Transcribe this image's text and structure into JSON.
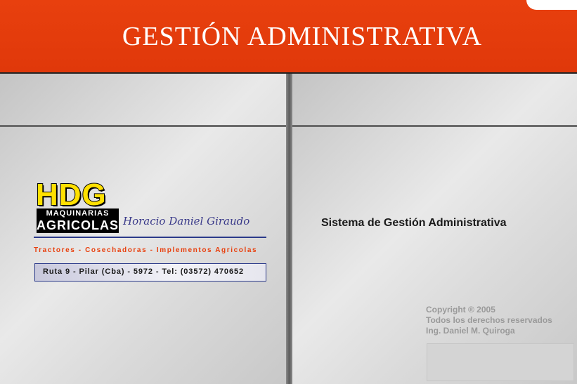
{
  "header": {
    "title": "GESTIÓN ADMINISTRATIVA"
  },
  "logo": {
    "brand": "HDG",
    "line1": "MAQUINARIAS",
    "line2": "AGRICOLAS",
    "owner": "Horacio Daniel Giraudo"
  },
  "company": {
    "products": "Tractores - Cosechadoras - Implementos Agricolas",
    "address": "Ruta 9 - Pilar (Cba) - 5972 - Tel: (03572) 470652"
  },
  "main": {
    "system_title": "Sistema de Gestión Administrativa"
  },
  "footer": {
    "copyright": "Copyright ® 2005",
    "rights": "Todos los derechos reservados",
    "author": "Ing. Daniel M. Quiroga"
  },
  "colors": {
    "header_bg": "#e8400e",
    "brand_yellow": "#ffe000",
    "accent_blue": "#2b3a8a",
    "panel_gray": "#d2d2d2"
  }
}
